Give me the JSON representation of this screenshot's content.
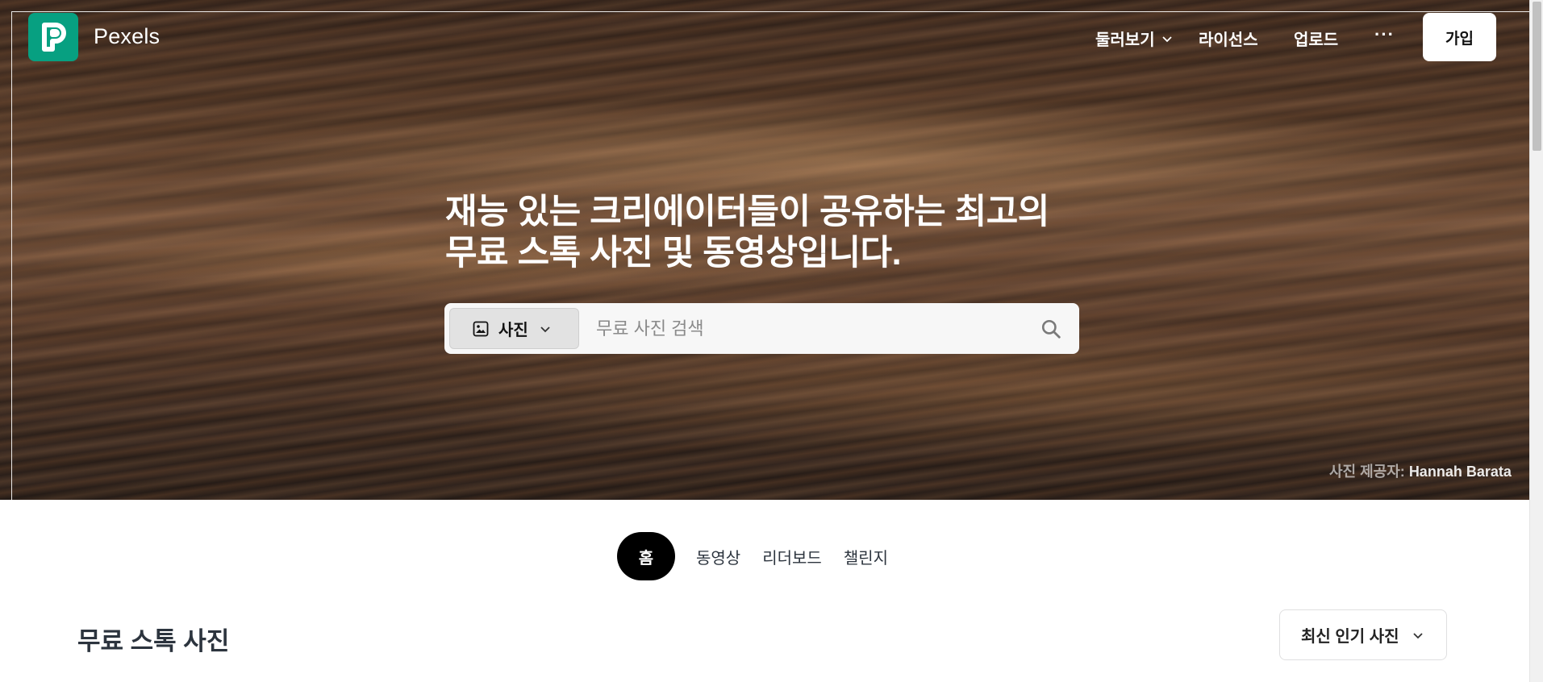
{
  "header": {
    "brand": "Pexels",
    "nav": {
      "explore": "둘러보기",
      "license": "라이선스",
      "upload": "업로드",
      "more": "···"
    },
    "join_label": "가입"
  },
  "hero": {
    "headline_line1": "재능 있는 크리에이터들이 공유하는 최고의",
    "headline_line2": "무료 스톡 사진 및 동영상입니다.",
    "search": {
      "type_label": "사진",
      "placeholder": "무료 사진 검색",
      "value": ""
    },
    "credit_prefix": "사진 제공자:",
    "credit_author": "Hannah Barata"
  },
  "tabs": [
    {
      "label": "홈",
      "active": true
    },
    {
      "label": "동영상",
      "active": false
    },
    {
      "label": "리더보드",
      "active": false
    },
    {
      "label": "챌린지",
      "active": false
    }
  ],
  "section": {
    "title": "무료 스톡 사진",
    "sort_label": "최신 인기 사진"
  },
  "icons": {
    "logo": "pexels-logo",
    "explore_chevron": "chevron-down-icon",
    "image": "image-icon",
    "search": "search-icon",
    "sort_chevron": "chevron-down-icon"
  },
  "colors": {
    "brand_green": "#07a081",
    "tab_active_bg": "#000000",
    "text_dark": "#2c343e"
  }
}
